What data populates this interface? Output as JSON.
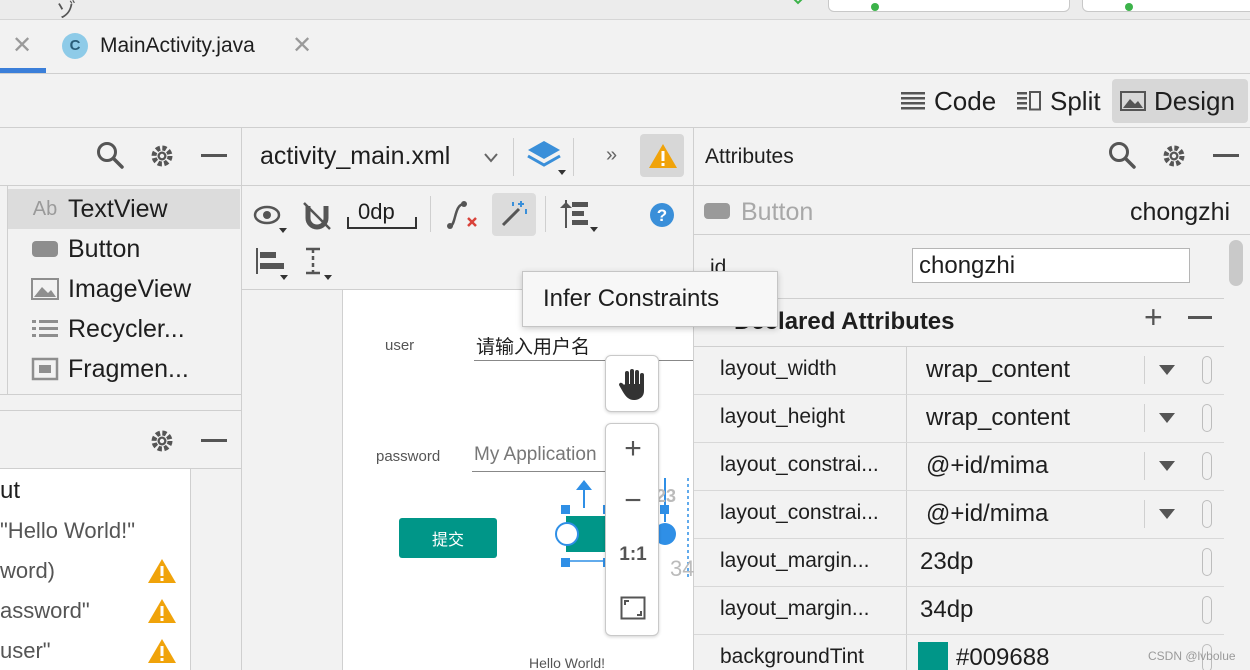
{
  "tabs": {
    "file_tab_label": "MainActivity.java",
    "file_tab_icon_letter": "C"
  },
  "view_modes": {
    "code": "Code",
    "split": "Split",
    "design": "Design",
    "active": "Design"
  },
  "palette": {
    "items": [
      {
        "label": "TextView",
        "icon_text": "Ab"
      },
      {
        "label": "Button"
      },
      {
        "label": "ImageView"
      },
      {
        "label": "Recycler..."
      },
      {
        "label": "Fragmen..."
      }
    ]
  },
  "component_tree": {
    "items": [
      {
        "label": "ut"
      },
      {
        "label": "\"Hello World!\""
      },
      {
        "label": "word)"
      },
      {
        "label": "assword\""
      },
      {
        "label": "user\""
      }
    ]
  },
  "design_toolbar": {
    "file_name": "activity_main.xml",
    "default_margin": "0dp"
  },
  "tooltip": {
    "text": "Infer Constraints"
  },
  "canvas": {
    "user_label": "user",
    "user_hint": "请输入用户名",
    "password_label": "password",
    "password_hint": "My Application",
    "submit_button": "提交",
    "hello_text": "Hello World!",
    "dim_23": "23",
    "dim_34": "34",
    "button_color": "#009688"
  },
  "zoom": {
    "plus": "+",
    "minus": "−",
    "one_to_one": "1:1"
  },
  "attributes": {
    "title": "Attributes",
    "widget_type": "Button",
    "widget_id": "chongzhi",
    "id_label": "id",
    "id_value": "chongzhi",
    "declared_title": "Declared Attributes",
    "rows": [
      {
        "name": "layout_width",
        "value": "wrap_content"
      },
      {
        "name": "layout_height",
        "value": "wrap_content"
      },
      {
        "name": "layout_constrai...",
        "value": "@+id/mima"
      },
      {
        "name": "layout_constrai...",
        "value": "@+id/mima"
      },
      {
        "name": "layout_margin...",
        "value": "23dp"
      },
      {
        "name": "layout_margin...",
        "value": "34dp"
      },
      {
        "name": "backgroundTint",
        "value": "#009688"
      }
    ]
  },
  "watermark": "CSDN @lvbolue"
}
